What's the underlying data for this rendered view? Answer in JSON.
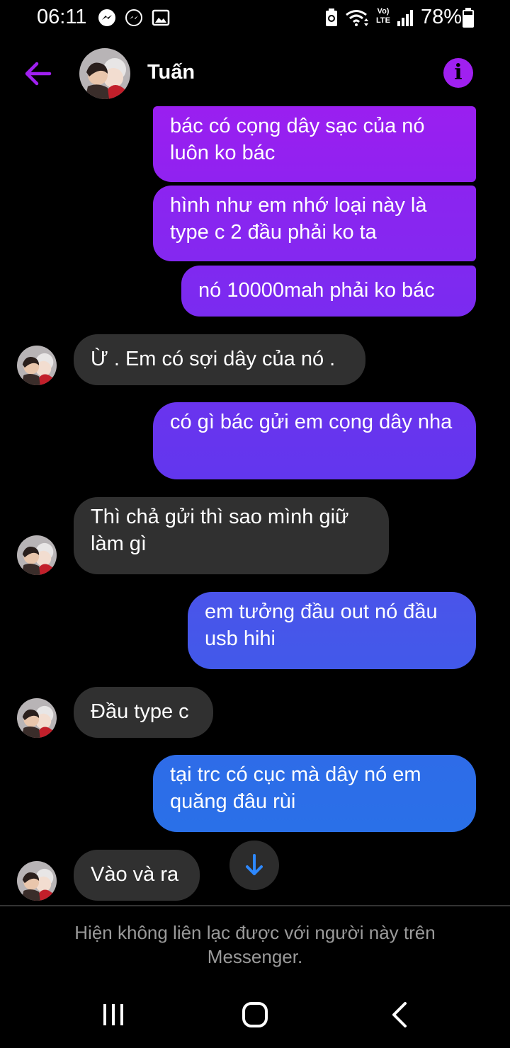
{
  "status_bar": {
    "time": "06:11",
    "battery_percent": "78%",
    "network_label_top": "Vo)",
    "network_label_bottom": "LTE",
    "notification_icons": [
      "messenger-icon",
      "messenger-outline-icon",
      "gallery-icon"
    ],
    "system_icons": [
      "battery-saver-icon",
      "wifi-icon",
      "volte-icon",
      "signal-icon",
      "battery-icon"
    ]
  },
  "header": {
    "contact_name": "Tuấn"
  },
  "messages": [
    {
      "direction": "out",
      "text": "bác có cọng dây sạc của nó luôn ko bác"
    },
    {
      "direction": "out",
      "text": "hình như em nhớ loại này là type c 2 đầu phải ko ta"
    },
    {
      "direction": "out",
      "text": "nó 10000mah phải ko bác"
    },
    {
      "direction": "in",
      "text": "Ừ . Em có sợi dây của nó ."
    },
    {
      "direction": "out",
      "text": "có gì bác gửi em cọng dây nha"
    },
    {
      "direction": "in",
      "text": "Thì chả gửi thì sao mình giữ làm gì"
    },
    {
      "direction": "out",
      "text": "em tưởng đầu out nó đầu usb hihi"
    },
    {
      "direction": "in",
      "text": "Đầu type c"
    },
    {
      "direction": "out",
      "text": "tại trc có cục mà dây nó em quăng đâu rùi"
    },
    {
      "direction": "in",
      "text": "Vào và ra"
    }
  ],
  "notice": {
    "text": "Hiện không liên lạc được với người này trên Messenger."
  },
  "colors": {
    "accent": "#a020f0",
    "bubble_out_1": "#9a1ff0",
    "bubble_out_2": "#7a2ff0",
    "bubble_out_3": "#6534ee",
    "bubble_out_4": "#4b55ea",
    "bubble_out_5": "#2c6ee8",
    "bubble_in": "#303030"
  }
}
